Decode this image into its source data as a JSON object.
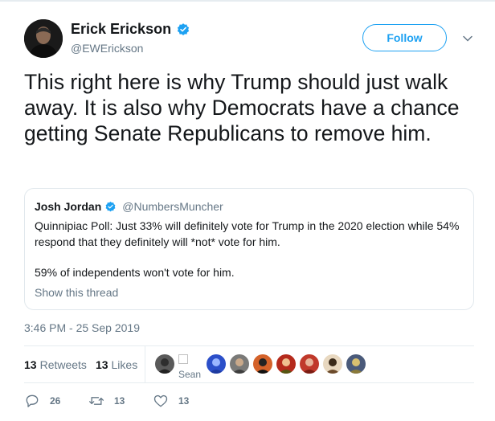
{
  "author": {
    "display_name": "Erick Erickson",
    "handle": "@EWErickson",
    "verified": true,
    "avatar_icon": "profile-photo"
  },
  "follow_label": "Follow",
  "tweet": {
    "text": "This right here is why Trump should just walk away. It is also why Democrats have a chance getting Senate Republicans to remove him.",
    "timestamp": "3:46 PM - 25 Sep 2019"
  },
  "quote": {
    "display_name": "Josh Jordan",
    "handle": "@NumbersMuncher",
    "verified": true,
    "text": "Quinnipiac Poll: Just 33% will definitely vote for Trump in the 2020 election while 54% respond that they definitely will *not* vote for him.",
    "text2": "59% of independents won't vote for him.",
    "thread_link": "Show this thread"
  },
  "stats": {
    "retweets_count": "13",
    "retweets_label": "Retweets",
    "likes_count": "13",
    "likes_label": "Likes"
  },
  "likers_alt_text": "Sean",
  "actions": {
    "reply_count": "26",
    "retweet_count": "13",
    "like_count": "13"
  },
  "colors": {
    "accent": "#1da1f2",
    "secondary_text": "#657786",
    "border": "#e1e8ed"
  }
}
